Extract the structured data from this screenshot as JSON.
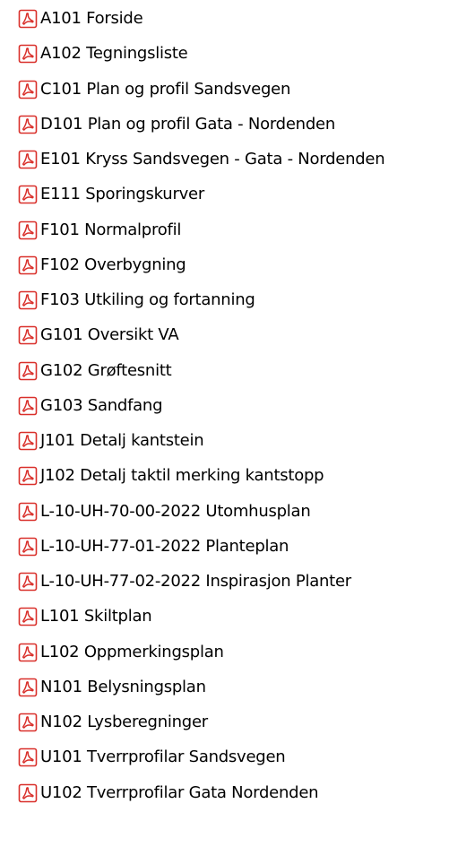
{
  "file_list": {
    "icon": "pdf-file-icon",
    "items": [
      {
        "label": "A101 Forside"
      },
      {
        "label": "A102 Tegningsliste"
      },
      {
        "label": "C101 Plan og profil Sandsvegen"
      },
      {
        "label": "D101 Plan og profil Gata - Nordenden"
      },
      {
        "label": "E101 Kryss Sandsvegen - Gata - Nordenden"
      },
      {
        "label": "E111 Sporingskurver"
      },
      {
        "label": "F101 Normalprofil"
      },
      {
        "label": "F102 Overbygning"
      },
      {
        "label": "F103 Utkiling og fortanning"
      },
      {
        "label": "G101 Oversikt VA"
      },
      {
        "label": "G102 Grøftesnitt"
      },
      {
        "label": "G103 Sandfang"
      },
      {
        "label": "J101 Detalj kantstein"
      },
      {
        "label": "J102 Detalj taktil merking kantstopp"
      },
      {
        "label": "L-10-UH-70-00-2022 Utomhusplan"
      },
      {
        "label": "L-10-UH-77-01-2022 Planteplan"
      },
      {
        "label": "L-10-UH-77-02-2022 Inspirasjon Planter"
      },
      {
        "label": "L101 Skiltplan"
      },
      {
        "label": "L102 Oppmerkingsplan"
      },
      {
        "label": "N101 Belysningsplan"
      },
      {
        "label": "N102 Lysberegninger"
      },
      {
        "label": "U101 Tverrprofilar Sandsvegen"
      },
      {
        "label": "U102 Tverrprofilar Gata Nordenden"
      }
    ]
  },
  "colors": {
    "pdf_icon": "#d9302b",
    "text": "#000000",
    "background": "#ffffff"
  }
}
